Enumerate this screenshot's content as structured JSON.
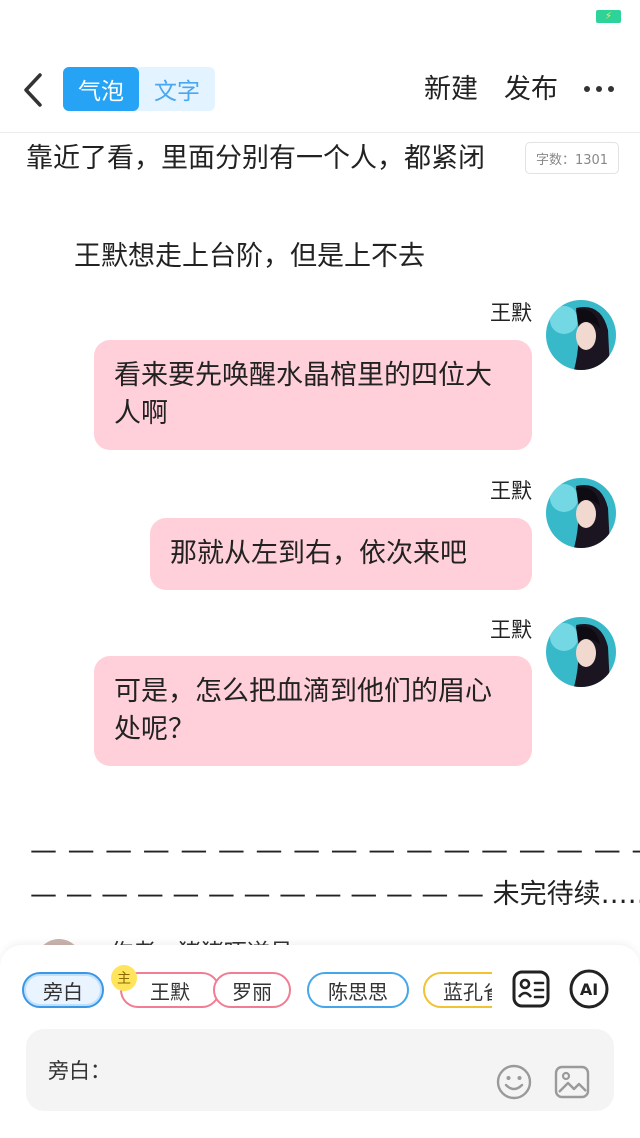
{
  "status": {
    "battery_icon": "battery-charging-icon"
  },
  "header": {
    "back_icon": "chevron-left-icon",
    "mode_options": [
      "气泡",
      "文字"
    ],
    "active_mode": "气泡",
    "new_label": "新建",
    "publish_label": "发布",
    "more_icon": "more-horizontal-icon"
  },
  "story": {
    "cut_text": "靠近了看，里面分别有一个人，都紧闭",
    "word_count": "字数：1301",
    "narration": "王默想走上台阶，但是上不去",
    "messages": [
      {
        "speaker": "王默",
        "text": "看来要先唤醒水晶棺里的四位大人啊"
      },
      {
        "speaker": "王默",
        "text": "那就从左到右，依次来吧"
      },
      {
        "speaker": "王默",
        "text": "可是，怎么把血滴到他们的眉心处呢？"
      }
    ],
    "end_dashes": "— — — — — — — — — — — — — — — — — — — —",
    "end_line": "— — — — — — — — — — — — — 未完待续……",
    "author_peek": "作者 · 猪猪吓逆号"
  },
  "characters": [
    {
      "name": "旁白",
      "color": "#3a97e6"
    },
    {
      "name": "王默",
      "color": "#f07d92",
      "badge": "主"
    },
    {
      "name": "罗丽",
      "color": "#f07d92"
    },
    {
      "name": "陈思思",
      "color": "#46a6ea"
    },
    {
      "name": "蓝孔雀",
      "color": "#f1c232"
    }
  ],
  "input": {
    "prefix": "旁白："
  },
  "tools": {
    "cards_icon": "character-cards-icon",
    "ai_label": "AI",
    "emoji_icon": "emoji-icon",
    "image_icon": "image-icon"
  },
  "colors": {
    "accent": "#27a3f5",
    "bubble": "#ffd0da"
  }
}
